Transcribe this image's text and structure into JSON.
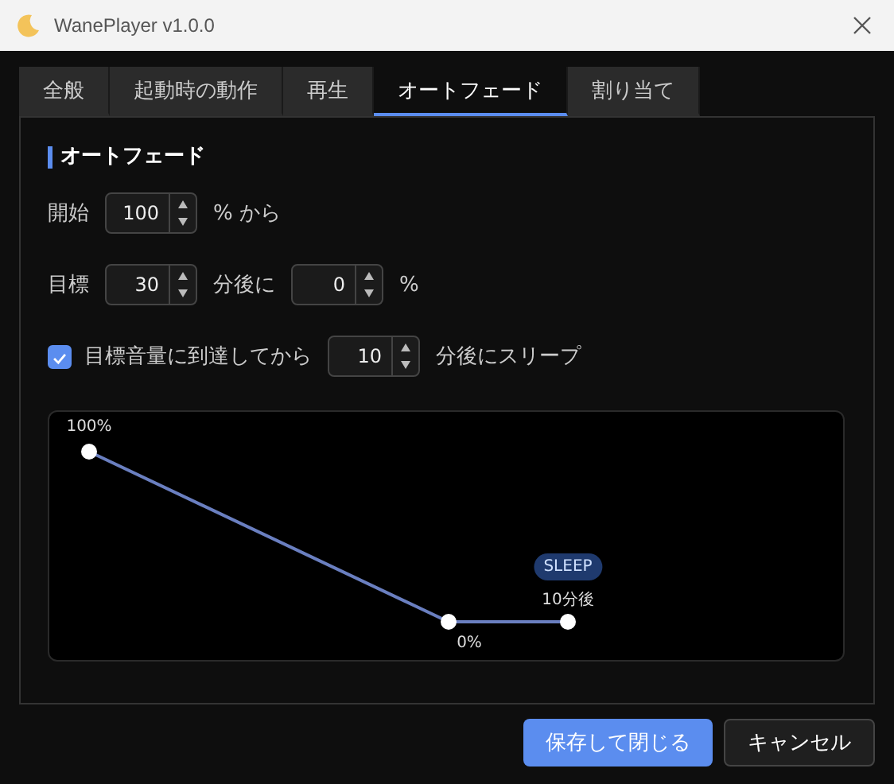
{
  "window": {
    "title": "WanePlayer v1.0.0"
  },
  "tabs": [
    {
      "label": "全般",
      "selected": false
    },
    {
      "label": "起動時の動作",
      "selected": false
    },
    {
      "label": "再生",
      "selected": false
    },
    {
      "label": "オートフェード",
      "selected": true
    },
    {
      "label": "割り当て",
      "selected": false
    }
  ],
  "section": {
    "heading": "オートフェード"
  },
  "rows": [
    [
      {
        "kind": "text",
        "text": "開始"
      },
      {
        "kind": "spin",
        "value": "100"
      },
      {
        "kind": "text",
        "text": "% から"
      }
    ],
    [
      {
        "kind": "text",
        "text": "目標"
      },
      {
        "kind": "spin",
        "value": "30"
      },
      {
        "kind": "text",
        "text": "分後に"
      },
      {
        "kind": "spin",
        "value": "0"
      },
      {
        "kind": "text",
        "text": "%"
      }
    ],
    [
      {
        "kind": "checkbox",
        "checked": true,
        "text": "目標音量に到達してから"
      },
      {
        "kind": "spin",
        "value": "10"
      },
      {
        "kind": "text",
        "text": "分後にスリープ"
      }
    ]
  ],
  "fade_graph": {
    "points": [
      {
        "label": "100%"
      },
      {
        "label": "0%"
      },
      {
        "label": "10分後",
        "badge": "SLEEP"
      }
    ]
  },
  "buttons": [
    {
      "label": "保存して閉じる",
      "kind": "primary"
    },
    {
      "label": "キャンセル",
      "kind": "secondary"
    }
  ]
}
